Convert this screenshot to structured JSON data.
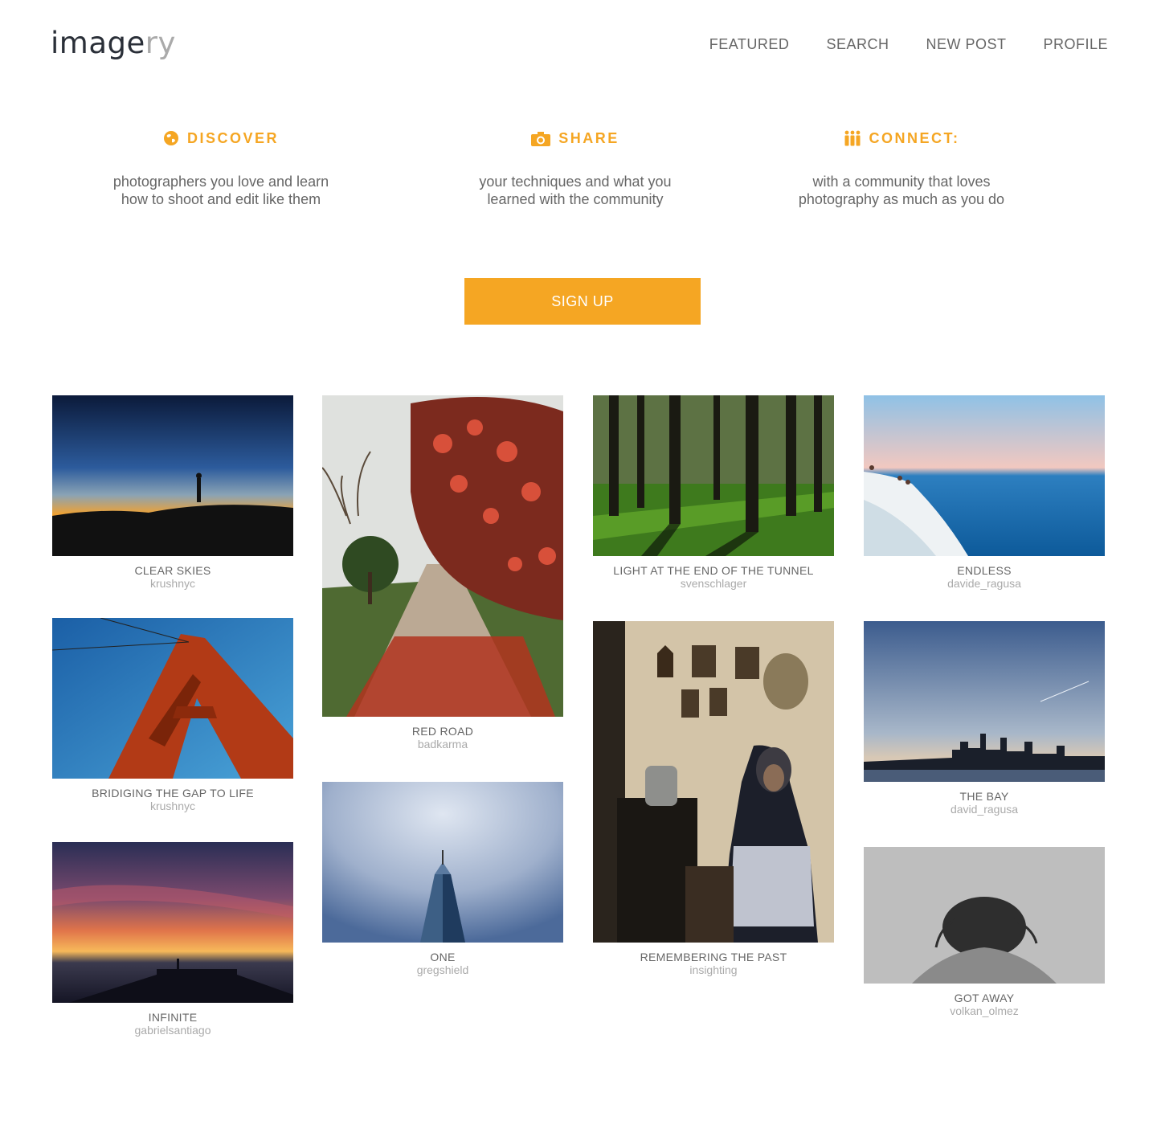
{
  "header": {
    "logo_main": "image",
    "logo_tail": "ry",
    "nav": [
      {
        "label": "FEATURED"
      },
      {
        "label": "SEARCH"
      },
      {
        "label": "NEW POST"
      },
      {
        "label": "PROFILE"
      }
    ]
  },
  "features": [
    {
      "icon": "globe-icon",
      "title": "DISCOVER",
      "text": "photographers you love and learn how to shoot and edit like them"
    },
    {
      "icon": "camera-icon",
      "title": "SHARE",
      "text": "your techniques and what you learned with the community"
    },
    {
      "icon": "people-icon",
      "title": "CONNECT:",
      "text": "with a community that loves photography as much as you do"
    }
  ],
  "cta": {
    "label": "SIGN UP"
  },
  "colors": {
    "accent": "#f5a623",
    "text": "#666666",
    "muted": "#aaaaaa"
  },
  "gallery": [
    {
      "title": "CLEAR SKIES",
      "user": "krushnyc",
      "scene": "silhouette at sunset horizon"
    },
    {
      "title": "BRIDIGING THE GAP TO LIFE",
      "user": "krushnyc",
      "scene": "red suspension bridge tower against blue sky"
    },
    {
      "title": "INFINITE",
      "user": "gabrielsantiago",
      "scene": "pier at dusk with colorful sky"
    },
    {
      "title": "RED ROAD",
      "user": "badkarma",
      "scene": "dirt road with red flowering tree"
    },
    {
      "title": "ONE",
      "user": "gregshield",
      "scene": "skyscraper against cloudy sky"
    },
    {
      "title": "LIGHT AT THE END OF THE TUNNEL",
      "user": "svenschlager",
      "scene": "sunlit forest with shadows"
    },
    {
      "title": "REMEMBERING THE PAST",
      "user": "insighting",
      "scene": "elderly woman seated beside stove and icons"
    },
    {
      "title": "ENDLESS",
      "user": "davide_ragusa",
      "scene": "white cliffs by the sea"
    },
    {
      "title": "THE BAY",
      "user": "david_ragusa",
      "scene": "city skyline across the bay at dusk"
    },
    {
      "title": "GOT AWAY",
      "user": "volkan_olmez",
      "scene": "grayscale portrait of a person with head down"
    }
  ]
}
